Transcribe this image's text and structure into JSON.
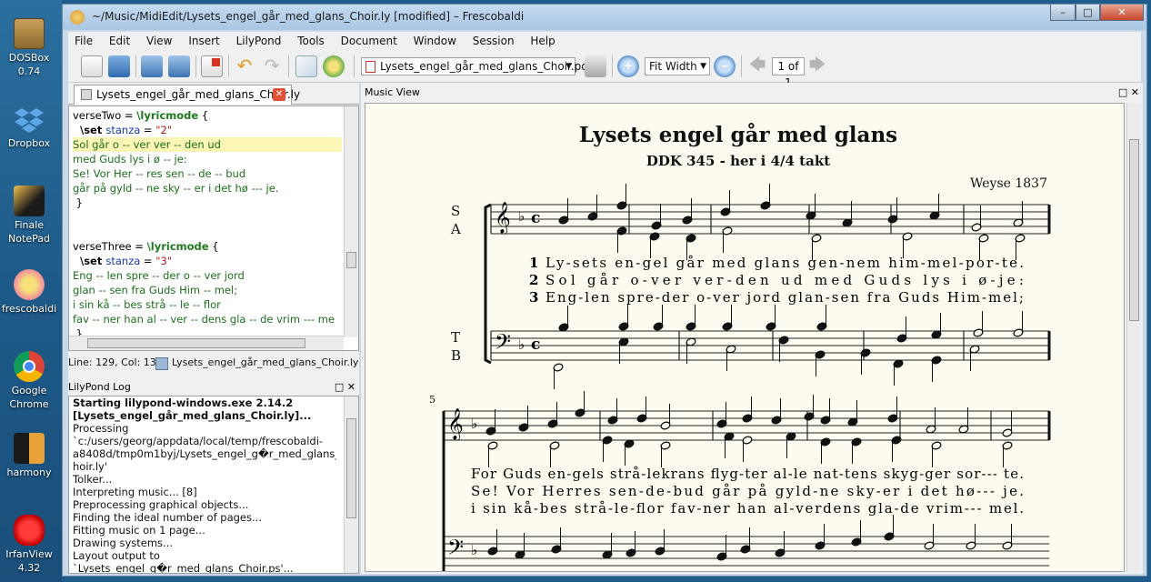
{
  "desktop": {
    "icons": [
      {
        "name": "dosbox",
        "label": "DOSBox 0.74"
      },
      {
        "name": "dropbox",
        "label": "Dropbox"
      },
      {
        "name": "finale",
        "label": "Finale NotePad"
      },
      {
        "name": "frescobaldi",
        "label": "frescobaldi"
      },
      {
        "name": "chrome",
        "label": "Google Chrome"
      },
      {
        "name": "harmony",
        "label": "harmony"
      },
      {
        "name": "irfanview",
        "label": "IrfanView 4.32"
      }
    ]
  },
  "window": {
    "title": "~/Music/MidiEdit/Lysets_engel_går_med_glans_Choir.ly [modified] – Frescobaldi"
  },
  "menu": [
    "File",
    "Edit",
    "View",
    "Insert",
    "LilyPond",
    "Tools",
    "Document",
    "Window",
    "Session",
    "Help"
  ],
  "toolbar": {
    "pdf_file": "Lysets_engel_går_med_glans_Choir.pdf",
    "zoom": "Fit Width",
    "page": "1 of 1"
  },
  "editor": {
    "tab": "Lysets_engel_går_med_glans_Choir.ly",
    "lines": [
      {
        "parts": [
          {
            "t": "verseTwo = ",
            "c": ""
          },
          {
            "t": "\\lyricmode",
            "c": "gr"
          },
          {
            "t": " {",
            "c": ""
          }
        ]
      },
      {
        "parts": [
          {
            "t": "  \\set ",
            "c": "kw"
          },
          {
            "t": "stanza",
            "c": "bl"
          },
          {
            "t": " = ",
            "c": ""
          },
          {
            "t": "\"2\"",
            "c": "rd"
          }
        ]
      },
      {
        "hl": true,
        "parts": [
          {
            "t": "Sol går o -- ver ver -- den ud",
            "c": "lyr"
          }
        ]
      },
      {
        "parts": [
          {
            "t": "med Guds lys i ø -- je:",
            "c": "lyr"
          }
        ]
      },
      {
        "parts": [
          {
            "t": "Se! Vor Her -- res sen -- de -- bud",
            "c": "lyr"
          }
        ]
      },
      {
        "parts": [
          {
            "t": "går på gyld -- ne sky -- er i det hø --- je.",
            "c": "lyr"
          }
        ]
      },
      {
        "parts": [
          {
            "t": " }",
            "c": ""
          }
        ]
      },
      {
        "parts": [
          {
            "t": "",
            "c": ""
          }
        ]
      },
      {
        "parts": [
          {
            "t": "",
            "c": ""
          }
        ]
      },
      {
        "parts": [
          {
            "t": "verseThree = ",
            "c": ""
          },
          {
            "t": "\\lyricmode",
            "c": "gr"
          },
          {
            "t": " {",
            "c": ""
          }
        ]
      },
      {
        "parts": [
          {
            "t": "  \\set ",
            "c": "kw"
          },
          {
            "t": "stanza",
            "c": "bl"
          },
          {
            "t": " = ",
            "c": ""
          },
          {
            "t": "\"3\"",
            "c": "rd"
          }
        ]
      },
      {
        "parts": [
          {
            "t": "Eng -- len spre -- der o -- ver jord",
            "c": "lyr"
          }
        ]
      },
      {
        "parts": [
          {
            "t": "glan -- sen fra Guds Him -- mel;",
            "c": "lyr"
          }
        ]
      },
      {
        "parts": [
          {
            "t": "i sin kå -- bes strå -- le -- flor",
            "c": "lyr"
          }
        ]
      },
      {
        "parts": [
          {
            "t": "fav -- ner han al -- ver -- dens gla -- de vrim --- me",
            "c": "lyr"
          }
        ]
      },
      {
        "parts": [
          {
            "t": " }",
            "c": ""
          }
        ]
      }
    ],
    "status_pos": "Line: 129, Col: 13",
    "status_file": "Lysets_engel_går_med_glans_Choir.ly"
  },
  "log": {
    "title": "LilyPond Log",
    "lines": [
      {
        "t": "Starting lilypond-windows.exe 2.14.2",
        "b": true
      },
      {
        "t": "[Lysets_engel_går_med_glans_Choir.ly]...",
        "b": true
      },
      {
        "t": "Processing",
        "b": false
      },
      {
        "t": "`c:/users/georg/appdata/local/temp/frescobaldi-",
        "b": false
      },
      {
        "t": "a8408d/tmp0m1byj/Lysets_engel_g�r_med_glans_C",
        "b": false
      },
      {
        "t": "hoir.ly'",
        "b": false
      },
      {
        "t": "Tolker...",
        "b": false
      },
      {
        "t": "Interpreting music... [8]",
        "b": false
      },
      {
        "t": "Preprocessing graphical objects...",
        "b": false
      },
      {
        "t": "Finding the ideal number of pages...",
        "b": false
      },
      {
        "t": "Fitting music on 1 page...",
        "b": false
      },
      {
        "t": "Drawing systems...",
        "b": false
      },
      {
        "t": "Layout output to",
        "b": false
      },
      {
        "t": "`Lysets_engel_g�r_med_glans_Choir.ps'...",
        "b": false
      }
    ]
  },
  "music_view": {
    "title": "Music View",
    "score_title": "Lysets engel går med glans",
    "subtitle": "DDK 345 - her i 4/4 takt",
    "composer": "Weyse 1837",
    "voices_upper": [
      "S",
      "A"
    ],
    "voices_lower": [
      "T",
      "B"
    ],
    "measure_number": "5",
    "system1_verses": [
      {
        "num": "1",
        "text": "Ly-sets en-gel går med glans gen-nem him-mel-por-te."
      },
      {
        "num": "2",
        "text": "Sol går o-ver ver-den ud med Guds lys i ø-je:"
      },
      {
        "num": "3",
        "text": "Eng-len spre-der o-ver jord glan-sen fra Guds Him-mel;"
      }
    ],
    "system2_verses": [
      {
        "text": "For Guds en-gels strå-lekrans flyg-ter al-le nat-tens skyg-ger sor--- te."
      },
      {
        "text": "Se! Vor Herres sen-de-bud går på gyld-ne sky-er i det hø--- je."
      },
      {
        "text": "i sin kå-bes strå-le-flor fav-ner han al-verdens gla-de vrim--- mel."
      }
    ]
  }
}
